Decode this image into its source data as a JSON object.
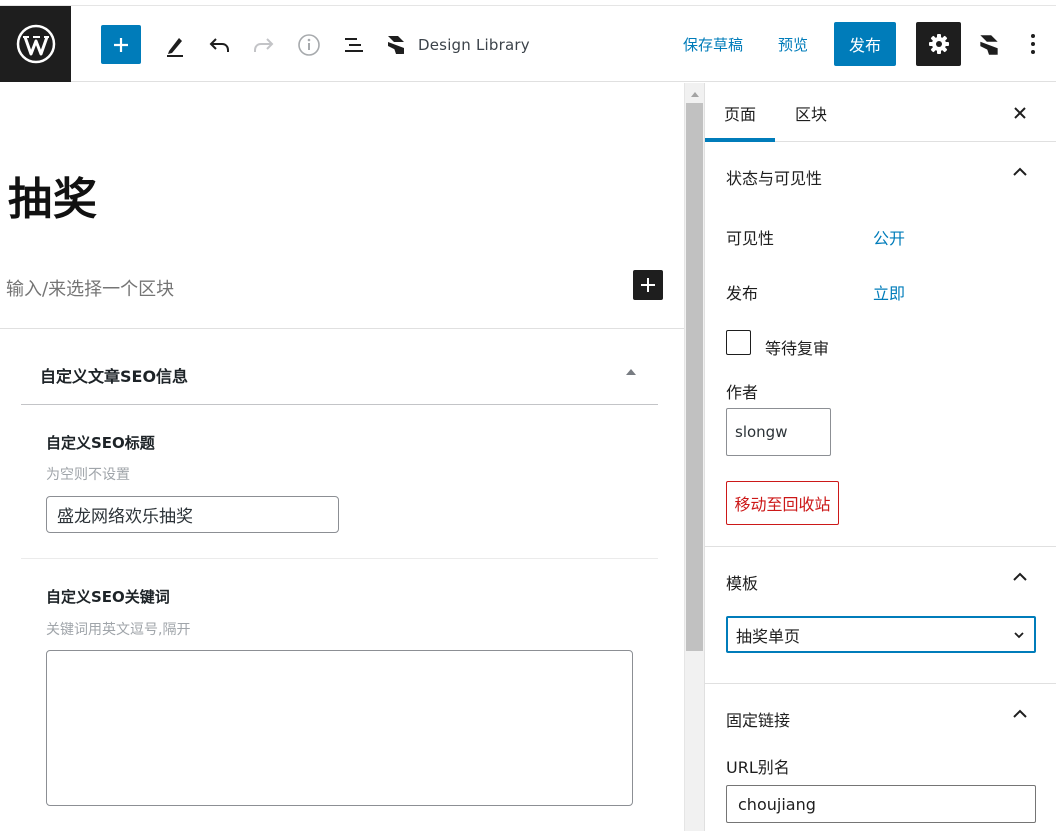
{
  "toolbar": {
    "design_library_label": "Design Library",
    "save_draft_label": "保存草稿",
    "preview_label": "预览",
    "publish_label": "发布"
  },
  "editor": {
    "title": "抽奖",
    "block_placeholder": "输入/来选择一个区块"
  },
  "metabox": {
    "title": "自定义文章SEO信息",
    "seo_title_label": "自定义SEO标题",
    "seo_title_hint": "为空则不设置",
    "seo_title_value": "盛龙网络欢乐抽奖",
    "seo_keywords_label": "自定义SEO关键词",
    "seo_keywords_hint": "关键词用英文逗号,隔开",
    "seo_keywords_value": ""
  },
  "sidebar": {
    "tabs": [
      {
        "label": "页面",
        "active": true
      },
      {
        "label": "区块",
        "active": false
      }
    ],
    "status_panel": {
      "title": "状态与可见性",
      "visibility_label": "可见性",
      "visibility_value": "公开",
      "publish_label": "发布",
      "publish_value": "立即",
      "pending_review_label": "等待复审",
      "pending_review_checked": false,
      "author_label": "作者",
      "author_value": "slongw",
      "trash_label": "移动至回收站"
    },
    "template_panel": {
      "title": "模板",
      "selected": "抽奖单页"
    },
    "permalink_panel": {
      "title": "固定链接",
      "slug_label": "URL别名",
      "slug_value": "choujiang"
    }
  },
  "colors": {
    "accent": "#007cba",
    "dark": "#1e1e1e",
    "danger": "#cc1818"
  }
}
